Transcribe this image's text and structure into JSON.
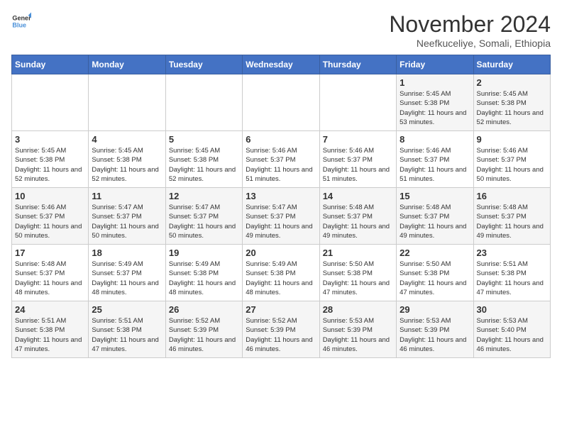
{
  "logo": {
    "text_general": "General",
    "text_blue": "Blue"
  },
  "title": "November 2024",
  "subtitle": "Neefkuceliye, Somali, Ethiopia",
  "days_of_week": [
    "Sunday",
    "Monday",
    "Tuesday",
    "Wednesday",
    "Thursday",
    "Friday",
    "Saturday"
  ],
  "weeks": [
    [
      {
        "day": "",
        "info": ""
      },
      {
        "day": "",
        "info": ""
      },
      {
        "day": "",
        "info": ""
      },
      {
        "day": "",
        "info": ""
      },
      {
        "day": "",
        "info": ""
      },
      {
        "day": "1",
        "info": "Sunrise: 5:45 AM\nSunset: 5:38 PM\nDaylight: 11 hours and 53 minutes."
      },
      {
        "day": "2",
        "info": "Sunrise: 5:45 AM\nSunset: 5:38 PM\nDaylight: 11 hours and 52 minutes."
      }
    ],
    [
      {
        "day": "3",
        "info": "Sunrise: 5:45 AM\nSunset: 5:38 PM\nDaylight: 11 hours and 52 minutes."
      },
      {
        "day": "4",
        "info": "Sunrise: 5:45 AM\nSunset: 5:38 PM\nDaylight: 11 hours and 52 minutes."
      },
      {
        "day": "5",
        "info": "Sunrise: 5:45 AM\nSunset: 5:38 PM\nDaylight: 11 hours and 52 minutes."
      },
      {
        "day": "6",
        "info": "Sunrise: 5:46 AM\nSunset: 5:37 PM\nDaylight: 11 hours and 51 minutes."
      },
      {
        "day": "7",
        "info": "Sunrise: 5:46 AM\nSunset: 5:37 PM\nDaylight: 11 hours and 51 minutes."
      },
      {
        "day": "8",
        "info": "Sunrise: 5:46 AM\nSunset: 5:37 PM\nDaylight: 11 hours and 51 minutes."
      },
      {
        "day": "9",
        "info": "Sunrise: 5:46 AM\nSunset: 5:37 PM\nDaylight: 11 hours and 50 minutes."
      }
    ],
    [
      {
        "day": "10",
        "info": "Sunrise: 5:46 AM\nSunset: 5:37 PM\nDaylight: 11 hours and 50 minutes."
      },
      {
        "day": "11",
        "info": "Sunrise: 5:47 AM\nSunset: 5:37 PM\nDaylight: 11 hours and 50 minutes."
      },
      {
        "day": "12",
        "info": "Sunrise: 5:47 AM\nSunset: 5:37 PM\nDaylight: 11 hours and 50 minutes."
      },
      {
        "day": "13",
        "info": "Sunrise: 5:47 AM\nSunset: 5:37 PM\nDaylight: 11 hours and 49 minutes."
      },
      {
        "day": "14",
        "info": "Sunrise: 5:48 AM\nSunset: 5:37 PM\nDaylight: 11 hours and 49 minutes."
      },
      {
        "day": "15",
        "info": "Sunrise: 5:48 AM\nSunset: 5:37 PM\nDaylight: 11 hours and 49 minutes."
      },
      {
        "day": "16",
        "info": "Sunrise: 5:48 AM\nSunset: 5:37 PM\nDaylight: 11 hours and 49 minutes."
      }
    ],
    [
      {
        "day": "17",
        "info": "Sunrise: 5:48 AM\nSunset: 5:37 PM\nDaylight: 11 hours and 48 minutes."
      },
      {
        "day": "18",
        "info": "Sunrise: 5:49 AM\nSunset: 5:37 PM\nDaylight: 11 hours and 48 minutes."
      },
      {
        "day": "19",
        "info": "Sunrise: 5:49 AM\nSunset: 5:38 PM\nDaylight: 11 hours and 48 minutes."
      },
      {
        "day": "20",
        "info": "Sunrise: 5:49 AM\nSunset: 5:38 PM\nDaylight: 11 hours and 48 minutes."
      },
      {
        "day": "21",
        "info": "Sunrise: 5:50 AM\nSunset: 5:38 PM\nDaylight: 11 hours and 47 minutes."
      },
      {
        "day": "22",
        "info": "Sunrise: 5:50 AM\nSunset: 5:38 PM\nDaylight: 11 hours and 47 minutes."
      },
      {
        "day": "23",
        "info": "Sunrise: 5:51 AM\nSunset: 5:38 PM\nDaylight: 11 hours and 47 minutes."
      }
    ],
    [
      {
        "day": "24",
        "info": "Sunrise: 5:51 AM\nSunset: 5:38 PM\nDaylight: 11 hours and 47 minutes."
      },
      {
        "day": "25",
        "info": "Sunrise: 5:51 AM\nSunset: 5:38 PM\nDaylight: 11 hours and 47 minutes."
      },
      {
        "day": "26",
        "info": "Sunrise: 5:52 AM\nSunset: 5:39 PM\nDaylight: 11 hours and 46 minutes."
      },
      {
        "day": "27",
        "info": "Sunrise: 5:52 AM\nSunset: 5:39 PM\nDaylight: 11 hours and 46 minutes."
      },
      {
        "day": "28",
        "info": "Sunrise: 5:53 AM\nSunset: 5:39 PM\nDaylight: 11 hours and 46 minutes."
      },
      {
        "day": "29",
        "info": "Sunrise: 5:53 AM\nSunset: 5:39 PM\nDaylight: 11 hours and 46 minutes."
      },
      {
        "day": "30",
        "info": "Sunrise: 5:53 AM\nSunset: 5:40 PM\nDaylight: 11 hours and 46 minutes."
      }
    ]
  ]
}
